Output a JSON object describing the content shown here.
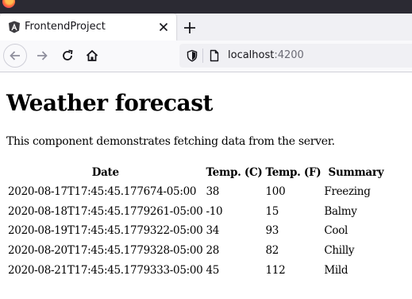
{
  "browser": {
    "tab": {
      "title": "FrontendProject"
    },
    "url": {
      "host": "localhost",
      "port": ":4200"
    }
  },
  "icons": {
    "favicon": "angular-icon",
    "close": "close-icon",
    "new_tab": "plus-icon",
    "back": "arrow-left-icon",
    "forward": "arrow-right-icon",
    "reload": "reload-icon",
    "home": "home-icon",
    "shield": "shield-icon",
    "page": "page-icon"
  },
  "page": {
    "heading": "Weather forecast",
    "intro": "This component demonstrates fetching data from the server.",
    "table": {
      "headers": [
        "Date",
        "Temp. (C)",
        "Temp. (F)",
        "Summary"
      ],
      "rows": [
        [
          "2020-08-17T17:45:45.177674-05:00",
          "38",
          "100",
          "Freezing"
        ],
        [
          "2020-08-18T17:45:45.1779261-05:00",
          "-10",
          "15",
          "Balmy"
        ],
        [
          "2020-08-19T17:45:45.1779322-05:00",
          "34",
          "93",
          "Cool"
        ],
        [
          "2020-08-20T17:45:45.1779328-05:00",
          "28",
          "82",
          "Chilly"
        ],
        [
          "2020-08-21T17:45:45.1779333-05:00",
          "45",
          "112",
          "Mild"
        ]
      ]
    }
  },
  "colors": {
    "titlebar": "#2b2a33",
    "tabstrip": "#f0f0f4",
    "toolbar": "#f9f9fb",
    "angular_red": "#dd0031"
  }
}
